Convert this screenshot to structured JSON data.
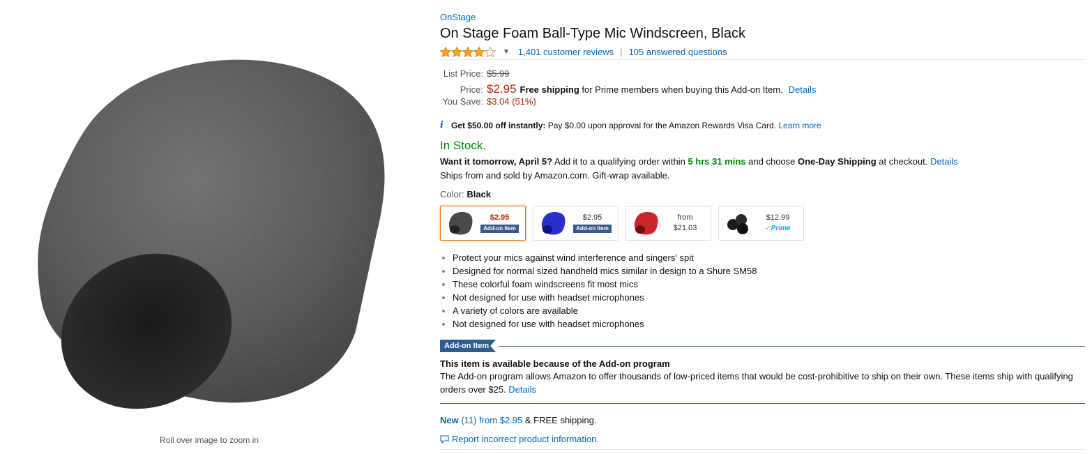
{
  "product": {
    "brand": "OnStage",
    "title": "On Stage Foam Ball-Type Mic Windscreen, Black",
    "rating": 4,
    "reviews_link": "1,401 customer reviews",
    "divider": "|",
    "questions_link": "105 answered questions",
    "zoom_hint": "Roll over image to zoom in"
  },
  "pricing": {
    "list_label": "List Price:",
    "list_price": "$5.99",
    "price_label": "Price:",
    "price": "$2.95",
    "free_shipping": "Free shipping",
    "shipping_note": " for Prime members when buying this Add-on Item.",
    "details_link": "Details",
    "save_label": "You Save:",
    "save_value": "$3.04 (51%)"
  },
  "promo": {
    "icon": "i",
    "bold_text": "Get $50.00 off instantly:",
    "text": " Pay $0.00 upon approval for the Amazon Rewards Visa Card. ",
    "link": "Learn more"
  },
  "availability": {
    "status": "In Stock.",
    "want_it": "Want it tomorrow, April 5?",
    "order_text": " Add it to a qualifying order within ",
    "countdown": "5 hrs 31 mins",
    "choose_text": " and choose ",
    "one_day": "One-Day Shipping",
    "checkout_text": " at checkout. ",
    "details_link": "Details",
    "ships_from": "Ships from and sold by Amazon.com. Gift-wrap available."
  },
  "color": {
    "label": "Color:",
    "selected": "Black",
    "options": [
      {
        "name": "Black",
        "line1": "$2.95",
        "badge": "Add-on Item",
        "thumb_color": "#4a4a4a"
      },
      {
        "name": "Blue",
        "line1": "$2.95",
        "badge": "Add-on Item",
        "thumb_color": "#2a2fc9"
      },
      {
        "name": "Red",
        "line1": "from",
        "line2": "$21.03",
        "thumb_color": "#c8262a"
      },
      {
        "name": "Multi",
        "line1": "$12.99",
        "prime": "Prime",
        "thumb_color": "#1a1a1a"
      }
    ]
  },
  "bullets": [
    "Protect your mics against wind interference and singers' spit",
    "Designed for normal sized handheld mics similar in design to a Shure SM58",
    "These colorful foam windscreens fit most mics",
    "Not designed for use with headset microphones",
    "A variety of colors are available",
    "Not designed for use with headset microphones"
  ],
  "addon": {
    "tag": "Add-on Item",
    "heading": "This item is available because of the Add-on program",
    "text": "The Add-on program allows Amazon to offer thousands of low-priced items that would be cost-prohibitive to ship on their own. These items ship with qualifying orders over $25. ",
    "details_link": "Details"
  },
  "offers": {
    "new_label": "New",
    "count_text": " (11) from $2.95",
    "shipping_text": " & FREE shipping."
  },
  "report": {
    "link": "Report incorrect product information."
  },
  "colors": {
    "link": "#0066c0",
    "price_red": "#b12704",
    "stock_green": "#008a00",
    "addon_blue": "#2f5b8f"
  }
}
